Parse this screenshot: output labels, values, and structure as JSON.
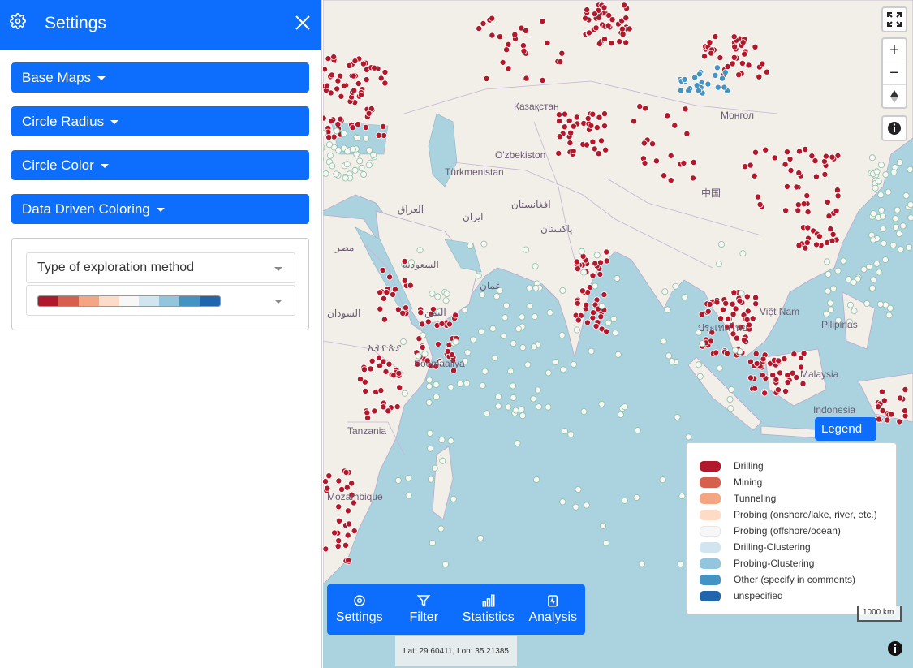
{
  "sidebar": {
    "title": "Settings",
    "dropdowns": [
      "Base Maps",
      "Circle Radius",
      "Circle Color",
      "Data Driven Coloring"
    ],
    "attribute_select": "Type of exploration method",
    "ramp_colors": [
      "#b2182b",
      "#d6604d",
      "#f4a582",
      "#fddbc7",
      "#f7f7f7",
      "#d1e5f0",
      "#92c5de",
      "#4393c3",
      "#2166ac"
    ]
  },
  "map": {
    "labels": [
      "Қазақстан",
      "O'zbekiston",
      "Türkmenistan",
      "افغانستان",
      "ایران",
      "العراق",
      "پاکستان",
      "中国",
      "السعودية",
      "مصر",
      "عمان",
      "اليمن",
      "السودان",
      "ኢትዮጵያ",
      "Soomaaliya",
      "Tanzania",
      "Mozambique",
      "Việt Nam",
      "Pilipinas",
      "Malaysia",
      "Indonesia",
      "ประเทศไทย",
      "Монгол"
    ],
    "legend_button": "Legend",
    "legend": [
      {
        "label": "Drilling",
        "color": "#b2182b"
      },
      {
        "label": "Mining",
        "color": "#d6604d"
      },
      {
        "label": "Tunneling",
        "color": "#f4a582"
      },
      {
        "label": "Probing (onshore/lake, river, etc.)",
        "color": "#fddbc7"
      },
      {
        "label": "Probing (offshore/ocean)",
        "color": "#f7f7f7"
      },
      {
        "label": "Drilling-Clustering",
        "color": "#d1e5f0"
      },
      {
        "label": "Probing-Clustering",
        "color": "#92c5de"
      },
      {
        "label": "Other (specify in comments)",
        "color": "#4393c3"
      },
      {
        "label": "unspecified",
        "color": "#2166ac"
      }
    ],
    "scale": "1000 km",
    "coords": "Lat: 29.60411, Lon: 35.21385",
    "controls": {
      "zoom_in": "+",
      "zoom_out": "−"
    }
  },
  "bottom_bar": [
    "Settings",
    "Filter",
    "Statistics",
    "Analysis"
  ]
}
